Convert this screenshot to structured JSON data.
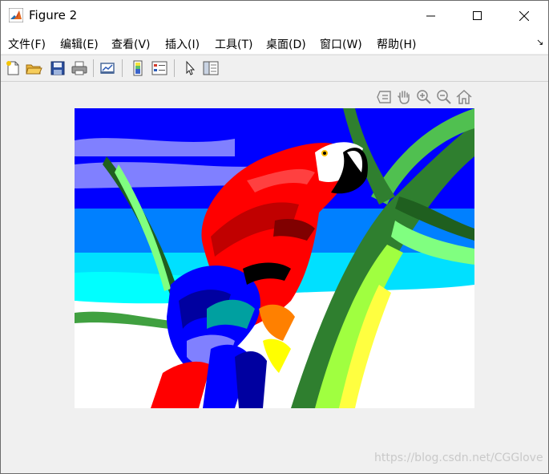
{
  "window": {
    "title": "Figure 2"
  },
  "menu": [
    {
      "label": "文件(F)"
    },
    {
      "label": "编辑(E)"
    },
    {
      "label": "查看(V)"
    },
    {
      "label": "插入(I)"
    },
    {
      "label": "工具(T)"
    },
    {
      "label": "桌面(D)"
    },
    {
      "label": "窗口(W)"
    },
    {
      "label": "帮助(H)"
    }
  ],
  "toolbar": {
    "icons": [
      "new-figure-icon",
      "open-file-icon",
      "save-icon",
      "print-icon",
      "link-plot-icon",
      "colorbar-icon",
      "legend-icon",
      "edit-plot-icon",
      "property-inspector-icon"
    ]
  },
  "axes_toolbar": {
    "icons": [
      "data-tips-icon",
      "pan-icon",
      "zoom-in-icon",
      "zoom-out-icon",
      "home-icon"
    ]
  },
  "image": {
    "subject": "posterized parrot image"
  },
  "watermark": "https://blog.csdn.net/CGGlove",
  "colors": {
    "accent": "#1f4fa0",
    "window_bg": "#f0f0f0"
  }
}
